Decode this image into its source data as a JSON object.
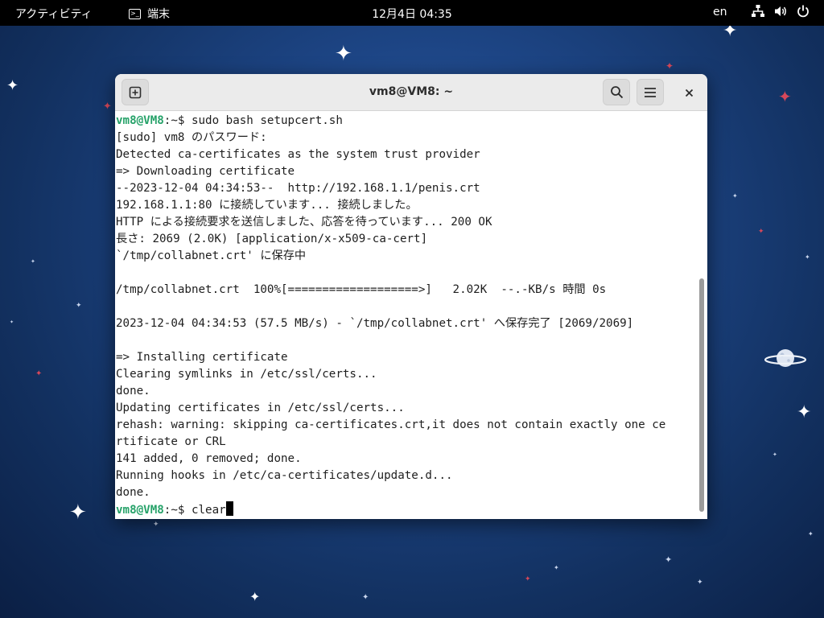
{
  "topbar": {
    "activities": "アクティビティ",
    "app_name": "端末",
    "clock": "12月4日  04:35",
    "input_language": "en"
  },
  "window": {
    "title": "vm8@VM8: ~"
  },
  "terminal": {
    "prompt_user": "vm8@VM8",
    "prompt_path": ":~$ ",
    "lines": [
      "sudo bash setupcert.sh",
      "[sudo] vm8 のパスワード:",
      "Detected ca-certificates as the system trust provider",
      "=> Downloading certificate",
      "--2023-12-04 04:34:53--  http://192.168.1.1/penis.crt",
      "192.168.1.1:80 に接続しています... 接続しました。",
      "HTTP による接続要求を送信しました、応答を待っています... 200 OK",
      "長さ: 2069 (2.0K) [application/x-x509-ca-cert]",
      "`/tmp/collabnet.crt' に保存中",
      "",
      "/tmp/collabnet.crt  100%[===================>]   2.02K  --.-KB/s 時間 0s",
      "",
      "2023-12-04 04:34:53 (57.5 MB/s) - `/tmp/collabnet.crt' へ保存完了 [2069/2069]",
      "",
      "=> Installing certificate",
      "Clearing symlinks in /etc/ssl/certs...",
      "done.",
      "Updating certificates in /etc/ssl/certs...",
      "rehash: warning: skipping ca-certificates.crt,it does not contain exactly one ce",
      "rtificate or CRL",
      "141 added, 0 removed; done.",
      "Running hooks in /etc/ca-certificates/update.d...",
      "done."
    ],
    "current_command": "clear"
  },
  "icons": {
    "new_tab": "new-tab-icon",
    "search": "search-icon",
    "menu": "hamburger-menu-icon",
    "close": "close-icon",
    "network": "network-icon",
    "volume": "volume-icon",
    "power": "power-icon"
  },
  "colors": {
    "prompt_green": "#26a269",
    "topbar": "#000000",
    "desktop_blue": "#1d4585"
  }
}
